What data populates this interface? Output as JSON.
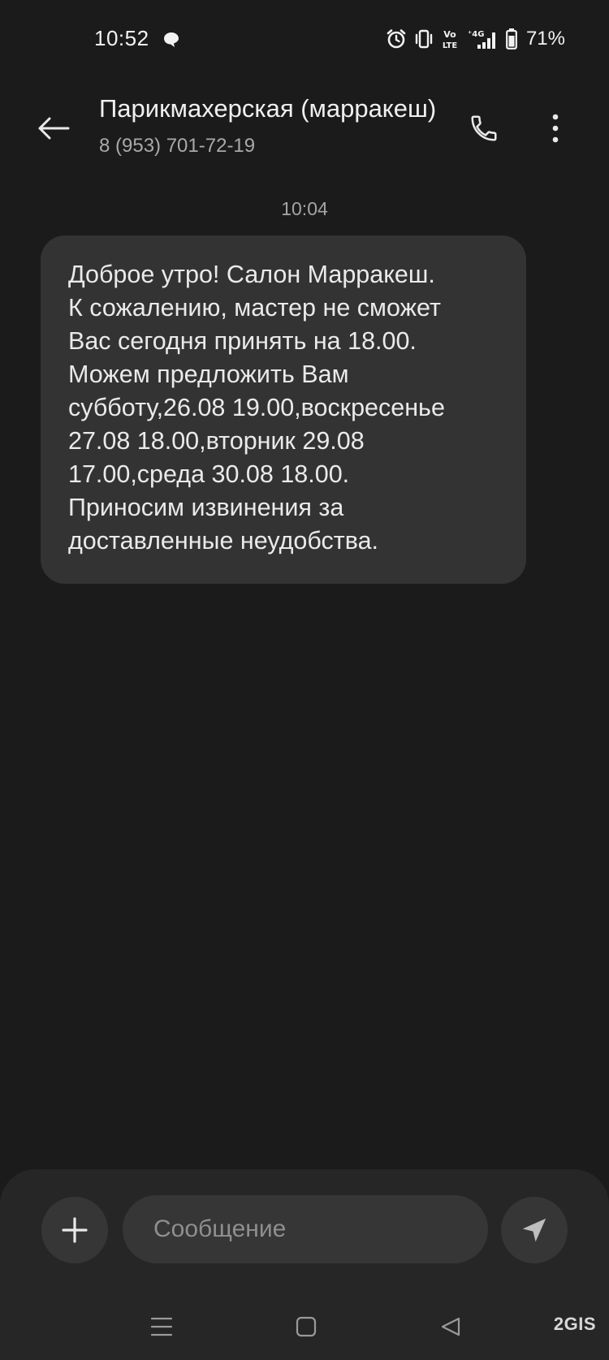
{
  "status_bar": {
    "time": "10:52",
    "network": "4G",
    "volte": "Vo LTE",
    "battery": "71%"
  },
  "header": {
    "contact_name": "Парикмахерская (марракеш)",
    "contact_number": "8 (953) 701-72-19"
  },
  "conversation": {
    "timestamp": "10:04",
    "messages": [
      {
        "direction": "incoming",
        "text": "Доброе утро! Салон Марракеш.\nК сожалению, мастер не сможет\nВас сегодня принять на 18.00.\nМожем предложить Вам\nсубботу,26.08 19.00,воскресенье\n27.08 18.00,вторник 29.08\n17.00,среда 30.08 18.00.\nПриносим извинения за\nдоставленные неудобства."
      }
    ]
  },
  "composer": {
    "placeholder": "Сообщение"
  },
  "watermark": "2GIS",
  "colors": {
    "background": "#1b1b1b",
    "bubble": "#333333",
    "composer": "#262626",
    "button": "#363636"
  }
}
